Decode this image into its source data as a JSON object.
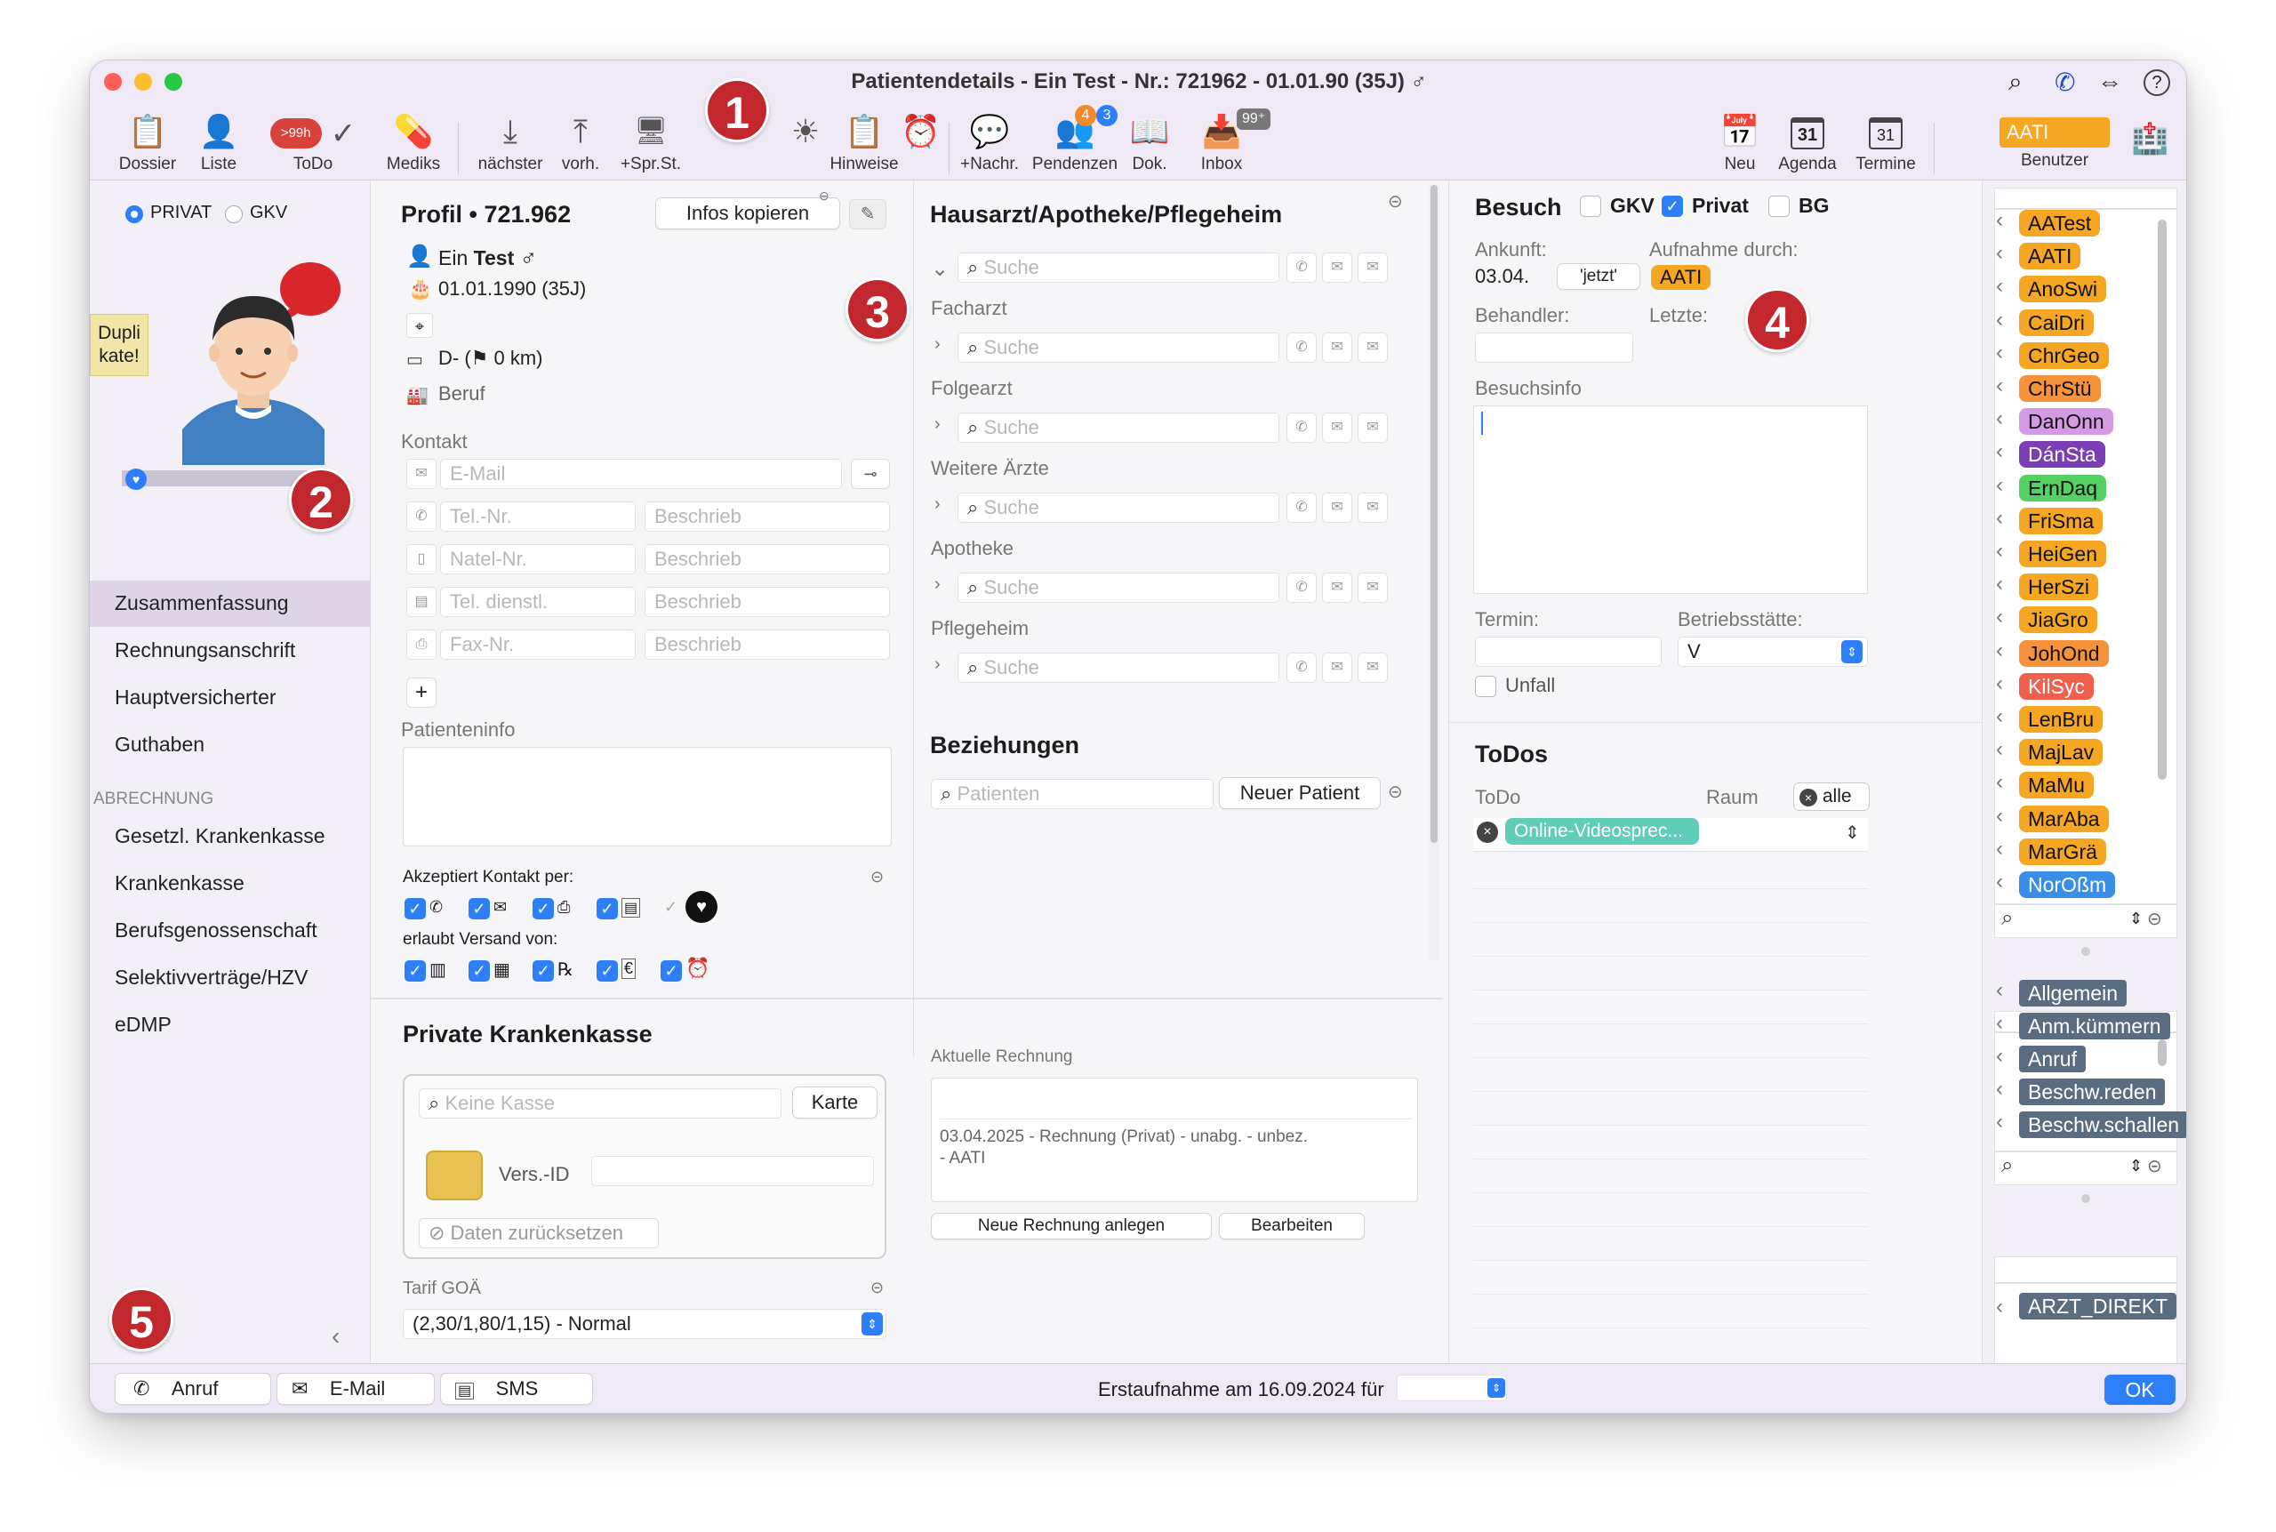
{
  "window": {
    "title": "Patientendetails - Ein Test - Nr.: 721962 - 01.01.90 (35J) ♂"
  },
  "toolbar": {
    "dossier": "Dossier",
    "liste": "Liste",
    "todo": "ToDo",
    "todo_badge": ">99h",
    "mediks": "Mediks",
    "naechster": "nächster",
    "vorh": "vorh.",
    "sprst": "+Spr.St.",
    "hinweise": "Hinweise",
    "nachr": "+Nachr.",
    "pendenzen": "Pendenzen",
    "pend_badge1": "4",
    "pend_badge2": "3",
    "dok": "Dok.",
    "inbox": "Inbox",
    "inbox_badge": "99⁺",
    "neu": "Neu",
    "agenda": "Agenda",
    "termine": "Termine",
    "agenda_day": "31",
    "termine_day": "31",
    "benutzer": "Benutzer",
    "benutzer_value": "AATI"
  },
  "markers": [
    "1",
    "2",
    "3",
    "4",
    "5"
  ],
  "left": {
    "privat": "PRIVAT",
    "gkv": "GKV",
    "duplikate": "Dupli\nkate!",
    "nav": [
      "Zusammenfassung",
      "Rechnungsanschrift",
      "Hauptversicherter",
      "Guthaben"
    ],
    "abrechnung_header": "ABRECHNUNG",
    "abrechnung": [
      "Gesetzl. Krankenkasse",
      "Krankenkasse",
      "Berufsgenossenschaft",
      "Selektivverträge/HZV",
      "eDMP"
    ]
  },
  "profil": {
    "title": "Profil •",
    "number": "721.962",
    "copy_btn": "Infos kopieren",
    "name_first": "Ein",
    "name_last": "Test",
    "gender": "♂",
    "birth": "01.01.1990 (35J)",
    "country": "D- (⚑ 0 km)",
    "beruf": "Beruf",
    "kontakt": "Kontakt",
    "email_ph": "E-Mail",
    "rows": [
      {
        "ph": "Tel.-Nr.",
        "desc": "Beschrieb"
      },
      {
        "ph": "Natel-Nr.",
        "desc": "Beschrieb"
      },
      {
        "ph": "Tel. dienstl.",
        "desc": "Beschrieb"
      },
      {
        "ph": "Fax-Nr.",
        "desc": "Beschrieb"
      }
    ],
    "plus": "+",
    "patienteninfo": "Patienteninfo",
    "akzeptiert": "Akzeptiert Kontakt per:",
    "erlaubt": "erlaubt Versand von:"
  },
  "hausarzt": {
    "title": "Hausarzt/Apotheke/Pflegeheim",
    "search_ph": "Suche",
    "groups": [
      "Facharzt",
      "Folgearzt",
      "Weitere Ärzte",
      "Apotheke",
      "Pflegeheim"
    ],
    "beziehungen": "Beziehungen",
    "patienten_ph": "Patienten",
    "neuer_patient": "Neuer Patient"
  },
  "pkk": {
    "title": "Private Krankenkasse",
    "kasse_ph": "Keine Kasse",
    "karte": "Karte",
    "versid": "Vers.-ID",
    "reset": "Daten zurücksetzen",
    "tarif_label": "Tarif GOÄ",
    "tarif_value": "(2,30/1,80/1,15) - Normal"
  },
  "rechnung": {
    "label": "Aktuelle Rechnung",
    "line1": "03.04.2025 - Rechnung (Privat) - unabg. - unbez.",
    "line2": "- AATI",
    "neu_btn": "Neue Rechnung anlegen",
    "bearbeiten_btn": "Bearbeiten"
  },
  "besuch": {
    "title": "Besuch",
    "gkv": "GKV",
    "privat": "Privat",
    "bg": "BG",
    "ankunft_label": "Ankunft:",
    "ankunft_value": "03.04.",
    "jetzt": "'jetzt'",
    "aufnahme_label": "Aufnahme durch:",
    "aufnahme_value": "AATI",
    "behandler_label": "Behandler:",
    "letzte_label": "Letzte:",
    "besuchsinfo_label": "Besuchsinfo",
    "termin_label": "Termin:",
    "betrieb_label": "Betriebsstätte:",
    "betrieb_value": "V",
    "unfall": "Unfall"
  },
  "todos": {
    "title": "ToDos",
    "col_todo": "ToDo",
    "col_raum": "Raum",
    "alle": "alle",
    "item": "Online-Videosprec..."
  },
  "users": [
    {
      "label": "AATest",
      "color": "#f5a623"
    },
    {
      "label": "AATI",
      "color": "#f5a623"
    },
    {
      "label": "AnoSwi",
      "color": "#f5a623"
    },
    {
      "label": "CaiDri",
      "color": "#f5a623"
    },
    {
      "label": "ChrGeo",
      "color": "#f5a623"
    },
    {
      "label": "ChrStü",
      "color": "#f5923a"
    },
    {
      "label": "DanOnn",
      "color": "#d49be4"
    },
    {
      "label": "DánSta",
      "color": "#7b3fb5"
    },
    {
      "label": "ErnDaq",
      "color": "#55d163"
    },
    {
      "label": "FriSma",
      "color": "#f5a623"
    },
    {
      "label": "HeiGen",
      "color": "#f5a623"
    },
    {
      "label": "HerSzi",
      "color": "#f5a623"
    },
    {
      "label": "JiaGro",
      "color": "#f5a623"
    },
    {
      "label": "JohOnd",
      "color": "#f5923a"
    },
    {
      "label": "KilSyc",
      "color": "#f0604d"
    },
    {
      "label": "LenBru",
      "color": "#f5a623"
    },
    {
      "label": "MajLav",
      "color": "#f5a623"
    },
    {
      "label": "MaMu",
      "color": "#f5a623"
    },
    {
      "label": "MarAba",
      "color": "#f5a623"
    },
    {
      "label": "MarGrä",
      "color": "#f5a623"
    },
    {
      "label": "NorOßm",
      "color": "#3a8ee6"
    }
  ],
  "tags": [
    "Allgemein",
    "Anm.kümmern",
    "Anruf",
    "Beschw.reden",
    "Beschw.schallen"
  ],
  "direct": "ARZT_DIREKT",
  "footer": {
    "anruf": "Anruf",
    "email": "E-Mail",
    "sms": "SMS",
    "erstaufnahme": "Erstaufnahme am 16.09.2024 für",
    "ok": "OK"
  }
}
